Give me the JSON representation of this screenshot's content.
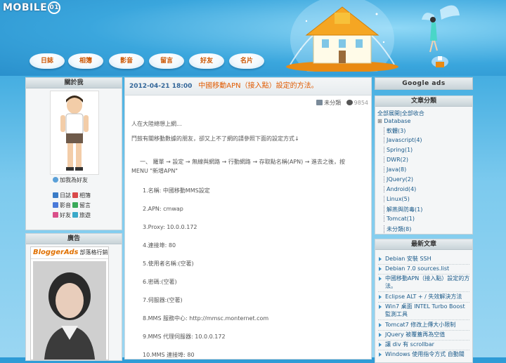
{
  "logo": {
    "text": "MOBILE",
    "mark": "01"
  },
  "nav": [
    "日誌",
    "相簿",
    "影音",
    "留言",
    "好友",
    "名片"
  ],
  "about": {
    "title": "關於我",
    "add_friend": "加我為好友",
    "links": [
      "日誌",
      "相簿",
      "影音",
      "留言",
      "好友",
      "旅遊"
    ]
  },
  "ads": {
    "title": "廣告",
    "brand": "BloggerAds",
    "brand_sub": "部落格行銷"
  },
  "post": {
    "date": "2012-04-21 18:00",
    "title": "中國移動APN（接入點）設定的方法。",
    "category": "未分類",
    "views": "9854",
    "lines": [
      "人在大陸總想上網...",
      "鬥鼓有關移動數據的朋友，卻又上不了網的請參照下面的設定方式↓",
      "一、 羅單 → 設定 → 無線與網路 → 行動網路 → 存取點名稱(APN) → 進去之後，按",
      "MENU \"新增APN\"",
      "1.名稱: 中國移動MMS設定",
      "2.APN: cmwap",
      "3.Proxy: 10.0.0.172",
      "4.連接埠: 80",
      "5.使用者名稱:(空著)",
      "6.密碼:(空著)",
      "7.伺服器:(空著)",
      "8.MMS 服務中心: http://mmsc.monternet.com",
      "9.MMS 代理伺服器: 10.0.0.172",
      "10.MMS 連接埠: 80"
    ]
  },
  "google_ads": "Google ads",
  "categories": {
    "title": "文章分類",
    "top": "全部展開|全部收合",
    "root": "Database",
    "items": [
      "軟體(3)",
      "Javascript(4)",
      "Spring(1)",
      "DWR(2)",
      "Java(8)",
      "JQuery(2)",
      "Android(4)",
      "Linux(5)",
      "解燕與防毒(1)",
      "Tomcat(1)",
      "未分類(8)"
    ]
  },
  "latest": {
    "title": "最新文章",
    "items": [
      "Debian 安裝 SSH",
      "Debian 7.0 sources.list",
      "中國移動APN（接入點）設定的方法。",
      "Eclipse ALT + / 失效解決方法",
      "Win7 桌面 INTEL Turbo Boost 監測工具",
      "Tomcat7 修改上傳大小限制",
      "JQuery 被覆蓋再為空值",
      "讓 div 有 scrollbar",
      "Windows 使用指令方式 自動關"
    ]
  },
  "colors": {
    "accent": "#e05a00",
    "link": "#1a5a8a",
    "sky": "#3aa6dd"
  }
}
